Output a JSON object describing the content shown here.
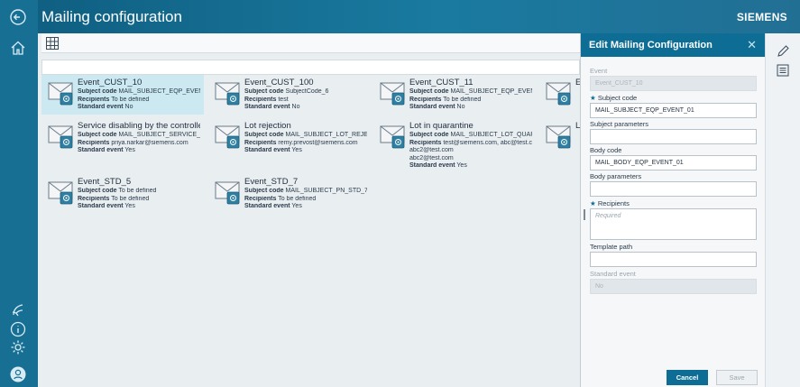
{
  "header": {
    "title": "Mailing configuration",
    "brand": "SIEMENS"
  },
  "rail": {
    "icons": [
      "back-icon",
      "home-icon",
      "contact-icon",
      "info-icon",
      "settings-icon",
      "user-avatar-icon"
    ]
  },
  "labels": {
    "subject_code": "Subject code",
    "recipients": "Recipients",
    "standard_event": "Standard event"
  },
  "cards": [
    {
      "name": "Event_CUST_10",
      "subject_code": "MAIL_SUBJECT_EQP_EVENT_...",
      "recipients": [
        "To be defined"
      ],
      "standard_event": "No",
      "selected": true
    },
    {
      "name": "Event_CUST_100",
      "subject_code": "SubjectCode_6",
      "recipients": [
        "test"
      ],
      "standard_event": "No",
      "selected": false
    },
    {
      "name": "Event_CUST_11",
      "subject_code": "MAIL_SUBJECT_EQP_EVENT_...",
      "recipients": [
        "To be defined"
      ],
      "standard_event": "No",
      "selected": false
    },
    {
      "name": "Ev",
      "subject_code": "",
      "recipients": [
        ""
      ],
      "standard_event": "",
      "selected": false
    },
    {
      "name": "Service disabling by the controller",
      "subject_code": "MAIL_SUBJECT_SERVICE_DIS...",
      "recipients": [
        "priya.narkar@siemens.com"
      ],
      "standard_event": "Yes",
      "selected": false
    },
    {
      "name": "Lot rejection",
      "subject_code": "MAIL_SUBJECT_LOT_REJECTE...",
      "recipients": [
        "remy.prevost@siemens.com"
      ],
      "standard_event": "Yes",
      "selected": false
    },
    {
      "name": "Lot in quarantine",
      "subject_code": "MAIL_SUBJECT_LOT_QUARA...",
      "recipients": [
        "test@siemens.com, abc@test.c...",
        "abc2@test.com",
        "abc2@test.com"
      ],
      "standard_event": "Yes",
      "selected": false
    },
    {
      "name": "Lo",
      "subject_code": "",
      "recipients": [
        ""
      ],
      "standard_event": "",
      "selected": false
    },
    {
      "name": "Event_STD_5",
      "subject_code": "To be defined",
      "recipients": [
        "To be defined"
      ],
      "standard_event": "Yes",
      "selected": false
    },
    {
      "name": "Event_STD_7",
      "subject_code": "MAIL_SUBJECT_PN_STD_7",
      "recipients": [
        "To be defined"
      ],
      "standard_event": "Yes",
      "selected": false
    }
  ],
  "panel": {
    "title": "Edit Mailing Configuration",
    "close_icon": "close-icon",
    "fields": {
      "event_label": "Event",
      "event_value": "Event_CUST_10",
      "subject_code_label": "Subject code",
      "subject_code_value": "MAIL_SUBJECT_EQP_EVENT_01",
      "subject_params_label": "Subject parameters",
      "subject_params_value": "",
      "body_code_label": "Body code",
      "body_code_value": "MAIL_BODY_EQP_EVENT_01",
      "body_params_label": "Body parameters",
      "body_params_value": "",
      "recipients_label": "Recipients",
      "recipients_placeholder": "Required",
      "template_path_label": "Template path",
      "template_path_value": "",
      "standard_event_label": "Standard event",
      "standard_event_value": "No"
    },
    "required_marker": "★",
    "cancel_label": "Cancel",
    "save_label": "Save"
  },
  "side_strip": {
    "icons": [
      "edit-icon",
      "details-icon"
    ]
  },
  "colors": {
    "accent": "#0d6d95",
    "selected_card": "#cce9f2",
    "header": "#176f93"
  }
}
